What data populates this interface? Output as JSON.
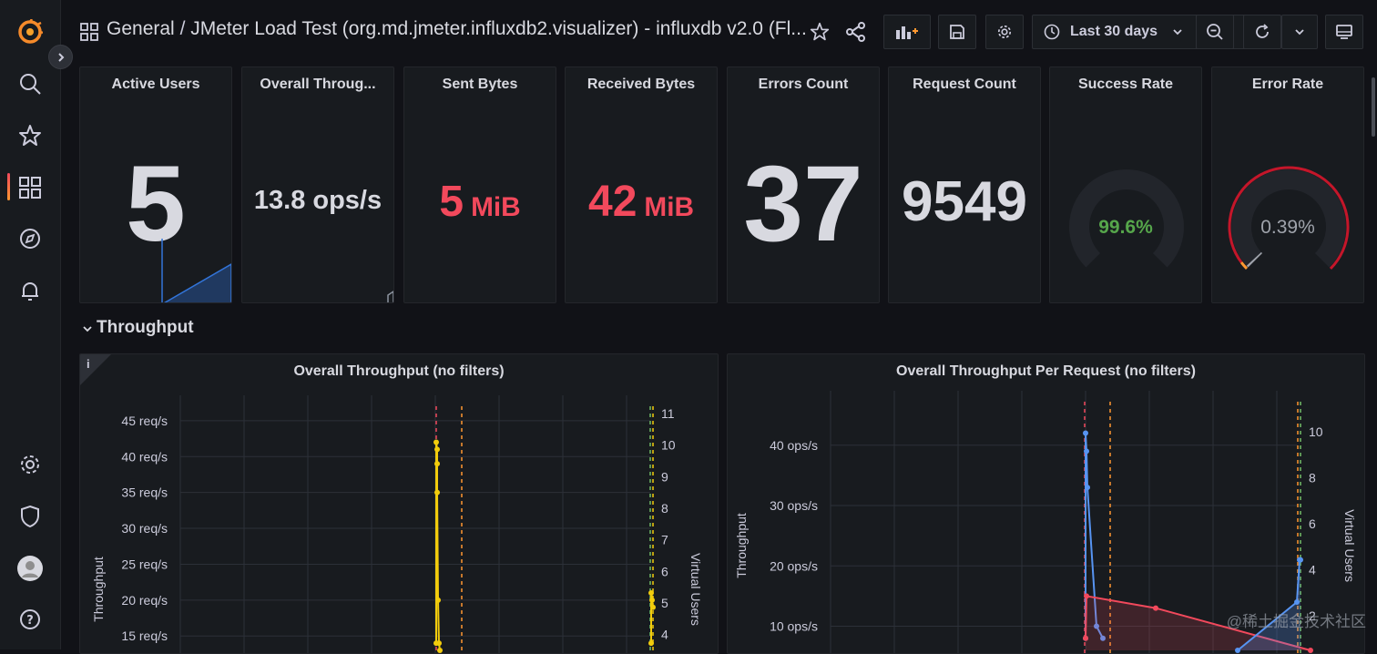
{
  "breadcrumb": {
    "folder": "General",
    "separator": "/",
    "dashboard": "JMeter Load Test (org.md.jmeter.influxdb2.visualizer) - influxdb v2.0 (Fl..."
  },
  "toolbar": {
    "time_range": "Last 30 days"
  },
  "stats": [
    {
      "title": "Active Users",
      "value": "5",
      "color": "#d8d9e0"
    },
    {
      "title": "Overall Throug...",
      "value": "13.8 ops/s",
      "color": "#d8d9e0"
    },
    {
      "title": "Sent Bytes",
      "value": "5",
      "unit": "MiB",
      "color": "#f2495c"
    },
    {
      "title": "Received Bytes",
      "value": "42",
      "unit": "MiB",
      "color": "#f2495c"
    },
    {
      "title": "Errors Count",
      "value": "37",
      "color": "#d8d9e0"
    },
    {
      "title": "Request Count",
      "value": "9549",
      "color": "#d8d9e0"
    },
    {
      "title": "Success Rate",
      "value": "99.6%",
      "percent": 99.6,
      "color": "#56a64b"
    },
    {
      "title": "Error Rate",
      "value": "0.39%",
      "percent": 0.39,
      "color": "#9fa3ab"
    }
  ],
  "row": {
    "title": "Throughput"
  },
  "panels": [
    {
      "title": "Overall Throughput (no filters)",
      "info": "i",
      "y_label": "Throughput",
      "y2_label": "Virtual Users",
      "y_ticks": [
        "45 req/s",
        "40 req/s",
        "35 req/s",
        "30 req/s",
        "25 req/s",
        "20 req/s",
        "15 req/s"
      ],
      "y2_ticks": [
        "11",
        "10",
        "9",
        "8",
        "7",
        "6",
        "5",
        "4"
      ]
    },
    {
      "title": "Overall Throughput Per Request (no filters)",
      "y_label": "Throughput",
      "y2_label": "Virtual Users",
      "y_ticks": [
        "40 ops/s",
        "30 ops/s",
        "20 ops/s",
        "10 ops/s"
      ],
      "y2_ticks": [
        "10",
        "8",
        "6",
        "4",
        "2"
      ]
    }
  ],
  "chart_data": [
    {
      "type": "line",
      "title": "Overall Throughput (no filters)",
      "ylabel": "Throughput",
      "y2label": "Virtual Users",
      "y_unit": "req/s",
      "ylim": [
        13,
        46
      ],
      "y2lim": [
        3.5,
        11
      ],
      "grid": true,
      "series": [
        {
          "values": [
            14,
            42,
            41,
            39,
            35,
            20,
            14,
            13
          ],
          "color": "#f2cc0c"
        },
        {
          "values": [
            14,
            21,
            20,
            19
          ],
          "color": "#f2cc0c"
        }
      ]
    },
    {
      "type": "line",
      "title": "Overall Throughput Per Request (no filters)",
      "ylabel": "Throughput",
      "y2label": "Virtual Users",
      "y_unit": "ops/s",
      "ylim": [
        6,
        46
      ],
      "y2lim": [
        0.5,
        11
      ],
      "grid": true,
      "series": [
        {
          "values": [
            8,
            42,
            39,
            33,
            10,
            8
          ],
          "color": "#5794f2"
        },
        {
          "values": [
            8,
            15,
            13,
            6
          ],
          "color": "#f2495c"
        },
        {
          "values": [
            6,
            14,
            21,
            21
          ],
          "color": "#5794f2"
        }
      ]
    }
  ],
  "watermark": "@稀土掘金技术社区"
}
